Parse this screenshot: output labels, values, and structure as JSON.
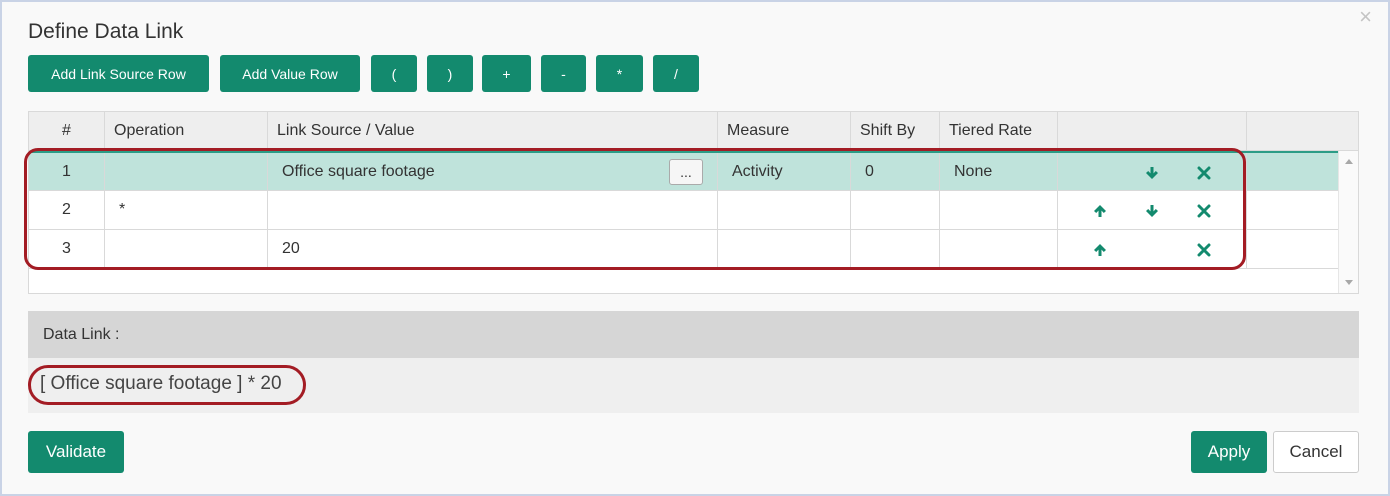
{
  "dialog": {
    "title": "Define Data Link",
    "close_label": "×"
  },
  "toolbar": {
    "add_link_source_row": "Add Link Source Row",
    "add_value_row": "Add Value Row",
    "open_paren": "(",
    "close_paren": ")",
    "plus": "+",
    "minus": "-",
    "multiply": "*",
    "divide": "/"
  },
  "grid": {
    "columns": [
      "#",
      "Operation",
      "Link Source / Value",
      "Measure",
      "Shift By",
      "Tiered Rate",
      ""
    ],
    "rows": [
      {
        "num": "1",
        "operation": "",
        "source": "Office square footage",
        "measure": "Activity",
        "shift_by": "0",
        "tiered_rate": "None",
        "selected": true,
        "has_browse": true,
        "browse_label": "...",
        "actions": [
          "arrow-down-icon",
          "delete-icon"
        ]
      },
      {
        "num": "2",
        "operation": "*",
        "source": "",
        "measure": "",
        "shift_by": "",
        "tiered_rate": "",
        "selected": false,
        "has_browse": false,
        "actions": [
          "arrow-up-icon",
          "arrow-down-icon",
          "delete-icon"
        ]
      },
      {
        "num": "3",
        "operation": "",
        "source": "20",
        "measure": "",
        "shift_by": "",
        "tiered_rate": "",
        "selected": false,
        "has_browse": false,
        "actions": [
          "arrow-up-icon",
          "delete-icon"
        ]
      }
    ]
  },
  "data_link": {
    "label": "Data Link :",
    "formula": "[ Office square footage ] * 20"
  },
  "footer": {
    "validate": "Validate",
    "apply": "Apply",
    "cancel": "Cancel"
  },
  "colors": {
    "accent": "#138a6e",
    "selected_row": "#bfe3db",
    "highlight_outline": "#a31c24"
  }
}
